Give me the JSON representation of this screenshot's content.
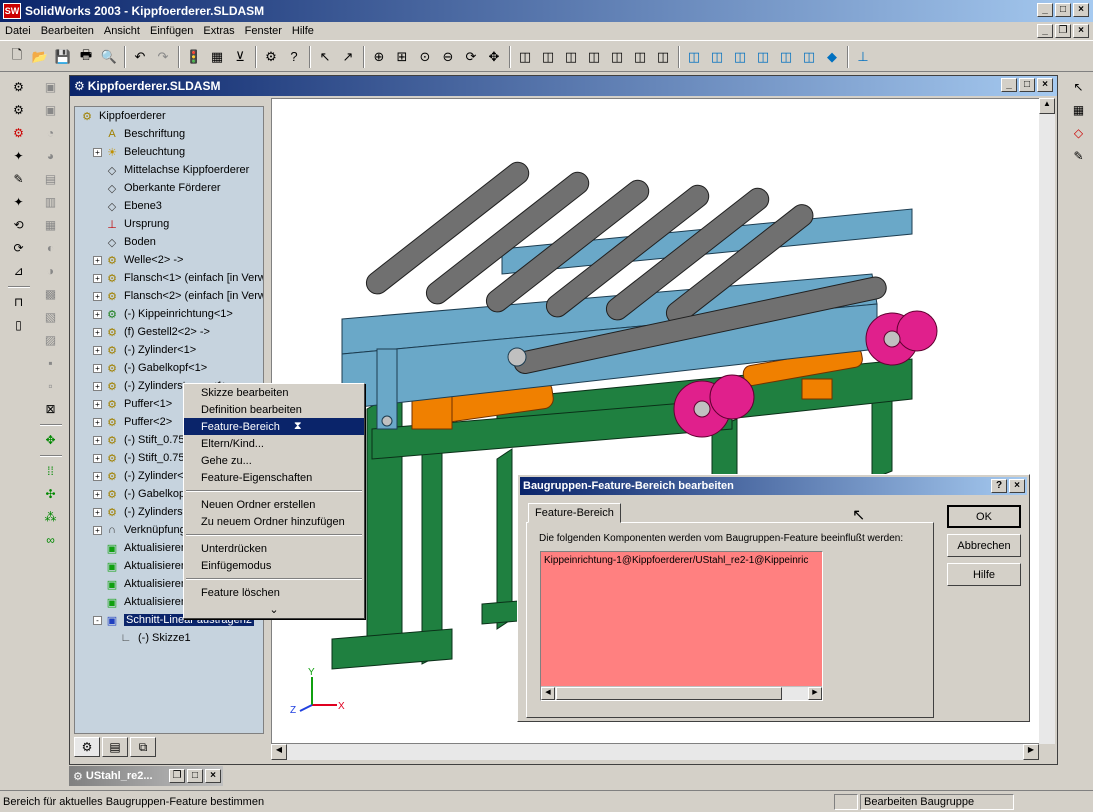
{
  "window": {
    "title": "SolidWorks 2003 - Kippfoerderer.SLDASM",
    "logo": "SW"
  },
  "menu": [
    "Datei",
    "Bearbeiten",
    "Ansicht",
    "Einfügen",
    "Extras",
    "Fenster",
    "Hilfe"
  ],
  "doc_window": {
    "title": "Kippfoerderer.SLDASM"
  },
  "tree": {
    "items": [
      {
        "label": "Kippfoerderer",
        "icon": "assembly-icon",
        "indent": 0,
        "expand": ""
      },
      {
        "label": "Beschriftung",
        "icon": "annotation-icon",
        "indent": 1,
        "expand": ""
      },
      {
        "label": "Beleuchtung",
        "icon": "lighting-icon",
        "indent": 1,
        "expand": "+"
      },
      {
        "label": "Mittelachse Kippfoerderer",
        "icon": "plane-icon",
        "indent": 1,
        "expand": ""
      },
      {
        "label": "Oberkante Förderer",
        "icon": "plane-icon",
        "indent": 1,
        "expand": ""
      },
      {
        "label": "Ebene3",
        "icon": "plane-icon",
        "indent": 1,
        "expand": ""
      },
      {
        "label": "Ursprung",
        "icon": "origin-icon",
        "indent": 1,
        "expand": ""
      },
      {
        "label": "Boden",
        "icon": "plane-icon",
        "indent": 1,
        "expand": ""
      },
      {
        "label": "Welle<2> ->",
        "icon": "part-icon",
        "indent": 1,
        "expand": "+"
      },
      {
        "label": "Flansch<1> (einfach [in Verwe",
        "icon": "part-icon",
        "indent": 1,
        "expand": "+"
      },
      {
        "label": "Flansch<2> (einfach [in Verwe",
        "icon": "part-icon",
        "indent": 1,
        "expand": "+"
      },
      {
        "label": "(-) Kippeinrichtung<1>",
        "icon": "subassembly-icon",
        "indent": 1,
        "expand": "+"
      },
      {
        "label": "(f) Gestell2<2> ->",
        "icon": "part-icon",
        "indent": 1,
        "expand": "+"
      },
      {
        "label": "(-) Zylinder<1>",
        "icon": "part-icon",
        "indent": 1,
        "expand": "+"
      },
      {
        "label": "(-) Gabelkopf<1>",
        "icon": "part-icon",
        "indent": 1,
        "expand": "+"
      },
      {
        "label": "(-) Zylinderstange<1>",
        "icon": "part-icon",
        "indent": 1,
        "expand": "+"
      },
      {
        "label": "Puffer<1>",
        "icon": "part-icon",
        "indent": 1,
        "expand": "+"
      },
      {
        "label": "Puffer<2>",
        "icon": "part-icon",
        "indent": 1,
        "expand": "+"
      },
      {
        "label": "(-) Stift_0.75x",
        "icon": "part-icon",
        "indent": 1,
        "expand": "+"
      },
      {
        "label": "(-) Stift_0.75x",
        "icon": "part-icon",
        "indent": 1,
        "expand": "+"
      },
      {
        "label": "(-) Zylinder<2>",
        "icon": "part-icon",
        "indent": 1,
        "expand": "+"
      },
      {
        "label": "(-) Gabelkopf<2>",
        "icon": "part-icon",
        "indent": 1,
        "expand": "+"
      },
      {
        "label": "(-) Zylinderstange<2>",
        "icon": "part-icon",
        "indent": 1,
        "expand": "+"
      },
      {
        "label": "VerknüpfungGruppe",
        "icon": "mate-icon",
        "indent": 1,
        "expand": "+"
      },
      {
        "label": "Aktualisieren E",
        "icon": "update-icon",
        "indent": 1,
        "expand": ""
      },
      {
        "label": "Aktualisieren E",
        "icon": "update-icon",
        "indent": 1,
        "expand": ""
      },
      {
        "label": "Aktualisieren E",
        "icon": "update-icon",
        "indent": 1,
        "expand": ""
      },
      {
        "label": "Aktualisieren E",
        "icon": "update-icon",
        "indent": 1,
        "expand": ""
      },
      {
        "label": "Schnitt-Linear austragen2",
        "icon": "cut-extrude-icon",
        "indent": 1,
        "expand": "-",
        "selected": true
      },
      {
        "label": "(-) Skizze1",
        "icon": "sketch-icon",
        "indent": 2,
        "expand": ""
      }
    ]
  },
  "context_menu": {
    "groups": [
      [
        "Skizze bearbeiten",
        "Definition bearbeiten",
        "Feature-Bereich",
        "Eltern/Kind...",
        "Gehe zu...",
        "Feature-Eigenschaften"
      ],
      [
        "Neuen Ordner erstellen",
        "Zu neuem Ordner hinzufügen"
      ],
      [
        "Unterdrücken",
        "Einfügemodus"
      ],
      [
        "Feature löschen"
      ]
    ],
    "highlighted": "Feature-Bereich",
    "more_glyph": "⌄"
  },
  "dialog": {
    "title": "Baugruppen-Feature-Bereich bearbeiten",
    "tab": "Feature-Bereich",
    "description": "Die folgenden Komponenten werden vom Baugruppen-Feature beeinflußt werden:",
    "list_items": [
      "Kippeinrichtung-1@Kippfoerderer/UStahl_re2-1@Kippeinric"
    ],
    "list_color": "#ff8080",
    "ok": "OK",
    "cancel": "Abbrechen",
    "help": "Hilfe"
  },
  "taskbar": {
    "minimized_doc": "UStahl_re2..."
  },
  "status": {
    "message": "Bereich für aktuelles Baugruppen-Feature bestimmen",
    "mode": "Bearbeiten Baugruppe"
  },
  "triad": {
    "x": "X",
    "y": "Y",
    "z": "Z"
  },
  "colors": {
    "frame_green": "#1f8040",
    "conveyor_blue": "#6aa8c8",
    "roller_gray": "#707070",
    "cylinder_orange": "#f08000",
    "flange_magenta": "#e0208c"
  }
}
